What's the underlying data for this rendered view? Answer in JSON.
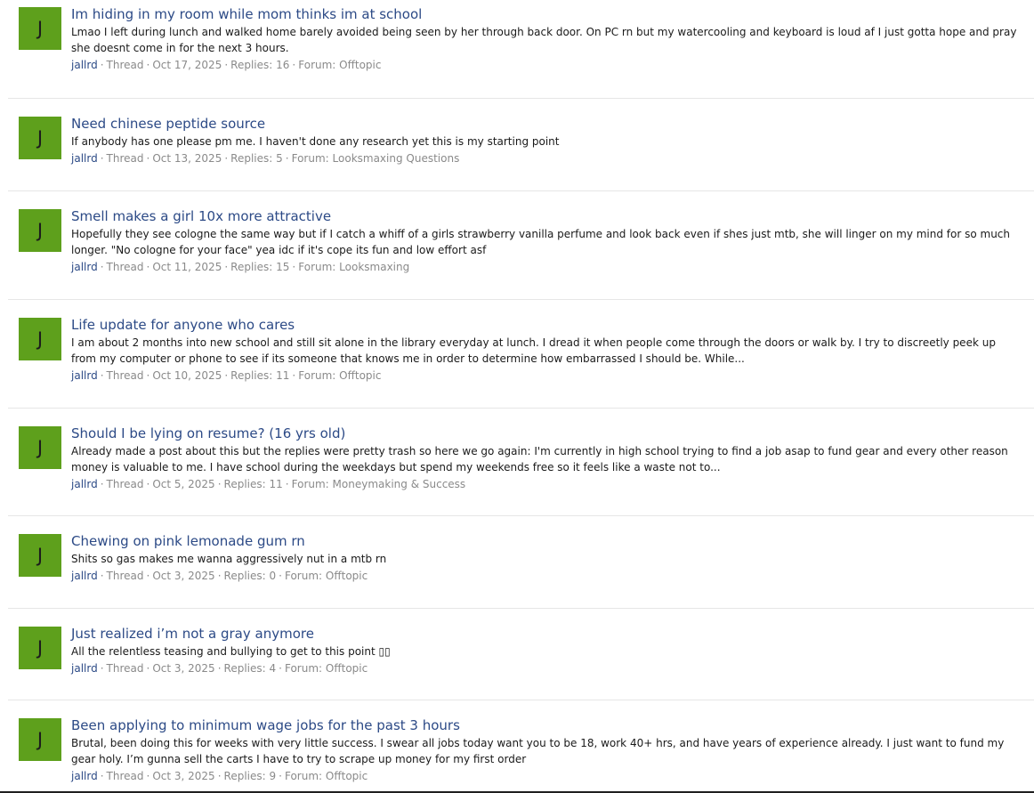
{
  "avatar_color": "#5ea01c",
  "link_color": "#2c4a86",
  "meta_labels": {
    "type": "Thread",
    "replies_prefix": "Replies:",
    "forum_prefix": "Forum:",
    "separator": "·"
  },
  "threads": [
    {
      "avatar_letter": "J",
      "title": "Im hiding in my room while mom thinks im at school",
      "snippet": "Lmao I left during lunch and walked home barely avoided being seen by her through back door. On PC rn but my watercooling and keyboard is loud af I just gotta hope and pray she doesnt come in for the next 3 hours.",
      "user": "jallrd",
      "date": "Oct 17, 2025",
      "replies": "16",
      "forum": "Offtopic"
    },
    {
      "avatar_letter": "J",
      "title": "Need chinese peptide source",
      "snippet": "If anybody has one please pm me. I haven't done any research yet this is my starting point",
      "user": "jallrd",
      "date": "Oct 13, 2025",
      "replies": "5",
      "forum": "Looksmaxing Questions"
    },
    {
      "avatar_letter": "J",
      "title": "Smell makes a girl 10x more attractive",
      "snippet": "Hopefully they see cologne the same way but if I catch a whiff of a girls strawberry vanilla perfume and look back even if shes just mtb, she will linger on my mind for so much longer. \"No cologne for your face\" yea idc if it's cope its fun and low effort asf",
      "user": "jallrd",
      "date": "Oct 11, 2025",
      "replies": "15",
      "forum": "Looksmaxing"
    },
    {
      "avatar_letter": "J",
      "title": "Life update for anyone who cares",
      "snippet": "I am about 2 months into new school and still sit alone in the library everyday at lunch. I dread it when people come through the doors or walk by. I try to discreetly peek up from my computer or phone to see if its someone that knows me in order to determine how embarrassed I should be. While...",
      "user": "jallrd",
      "date": "Oct 10, 2025",
      "replies": "11",
      "forum": "Offtopic"
    },
    {
      "avatar_letter": "J",
      "title": "Should I be lying on resume? (16 yrs old)",
      "snippet": "Already made a post about this but the replies were pretty trash so here we go again: I'm currently in high school trying to find a job asap to fund gear and every other reason money is valuable to me. I have school during the weekdays but spend my weekends free so it feels like a waste not to...",
      "user": "jallrd",
      "date": "Oct 5, 2025",
      "replies": "11",
      "forum": "Moneymaking & Success"
    },
    {
      "avatar_letter": "J",
      "title": "Chewing on pink lemonade gum rn",
      "snippet": "Shits so gas makes me wanna aggressively nut in a mtb rn",
      "user": "jallrd",
      "date": "Oct 3, 2025",
      "replies": "0",
      "forum": "Offtopic"
    },
    {
      "avatar_letter": "J",
      "title": "Just realized i’m not a gray anymore",
      "snippet": "All the relentless teasing and bullying to get to this point ▯▯",
      "user": "jallrd",
      "date": "Oct 3, 2025",
      "replies": "4",
      "forum": "Offtopic"
    },
    {
      "avatar_letter": "J",
      "title": "Been applying to minimum wage jobs for the past 3 hours",
      "snippet": "Brutal, been doing this for weeks with very little success. I swear all jobs today want you to be 18, work 40+ hrs, and have years of experience already. I just want to fund my gear holy. I’m gunna sell the carts I have to try to scrape up money for my first order",
      "user": "jallrd",
      "date": "Oct 3, 2025",
      "replies": "9",
      "forum": "Offtopic"
    }
  ]
}
